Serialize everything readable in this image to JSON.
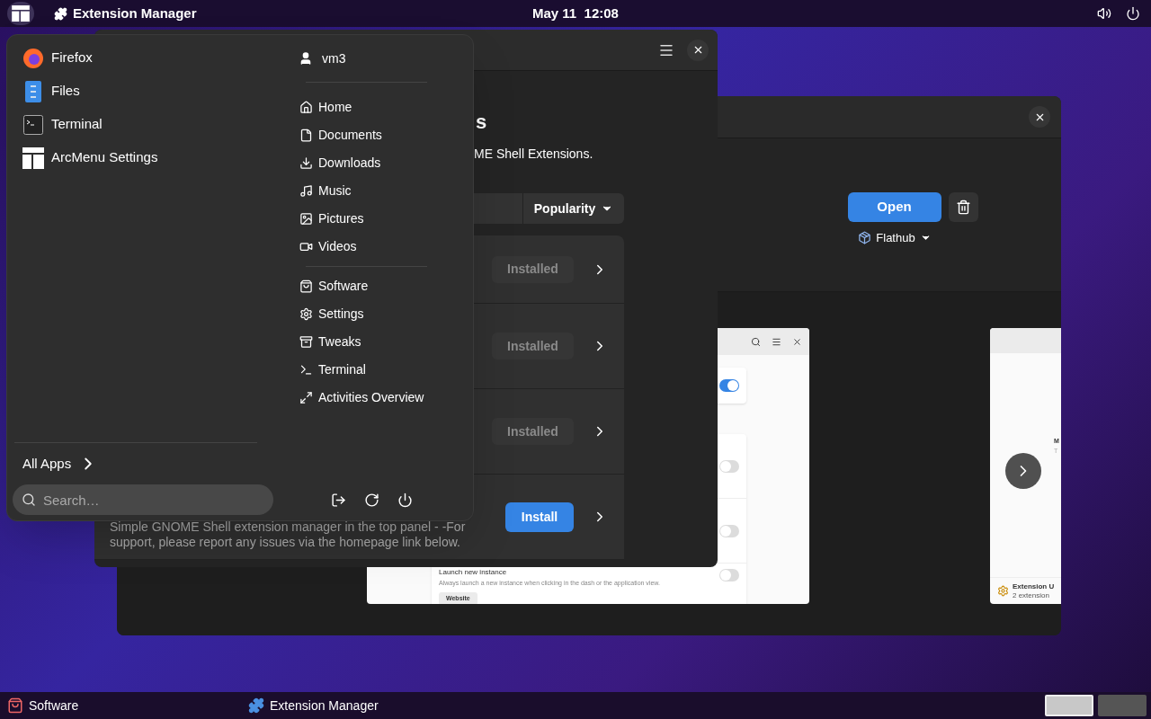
{
  "top_bar": {
    "menu_open": true,
    "app_name": "Extension Manager",
    "clock": "May 11  12:08"
  },
  "software_window": {
    "open_button": "Open",
    "source": "Flathub",
    "screenshot": {
      "settings": [
        {
          "on": true
        },
        {
          "on": false
        },
        {
          "on": false
        },
        {
          "on": false,
          "title": "Launch new instance",
          "description": "Always launch a new instance when clicking in the dash or the application view."
        }
      ],
      "link_button": "Website"
    },
    "screenshot_2": {
      "heading": "M",
      "subheading": "T",
      "footer_title": "Extension U",
      "footer_subtitle": "2 extension"
    }
  },
  "extension_manager_window": {
    "title": "s",
    "subtitle": "ME Shell Extensions.",
    "sort": "Popularity",
    "rows": [
      {
        "kind": "installed",
        "button": "Installed"
      },
      {
        "kind": "installed",
        "button": "Installed"
      },
      {
        "kind": "installed",
        "button": "Installed"
      },
      {
        "kind": "install",
        "button": "Install",
        "description": "Simple GNOME Shell extension manager in the top panel - -For support, please report any issues via the homepage link below."
      }
    ]
  },
  "arc_menu": {
    "pinned_apps": [
      "Firefox",
      "Files",
      "Terminal",
      "ArcMenu Settings"
    ],
    "user": "vm3",
    "places": [
      "Home",
      "Documents",
      "Downloads",
      "Music",
      "Pictures",
      "Videos"
    ],
    "apps": [
      "Software",
      "Settings",
      "Tweaks",
      "Terminal",
      "Activities Overview"
    ],
    "all_apps": "All Apps",
    "search": {
      "placeholder": "Search…"
    }
  },
  "taskbar": {
    "items": [
      "Software",
      "Extension Manager"
    ],
    "workspaces": [
      {
        "selected": true
      },
      {
        "selected": false
      }
    ]
  }
}
